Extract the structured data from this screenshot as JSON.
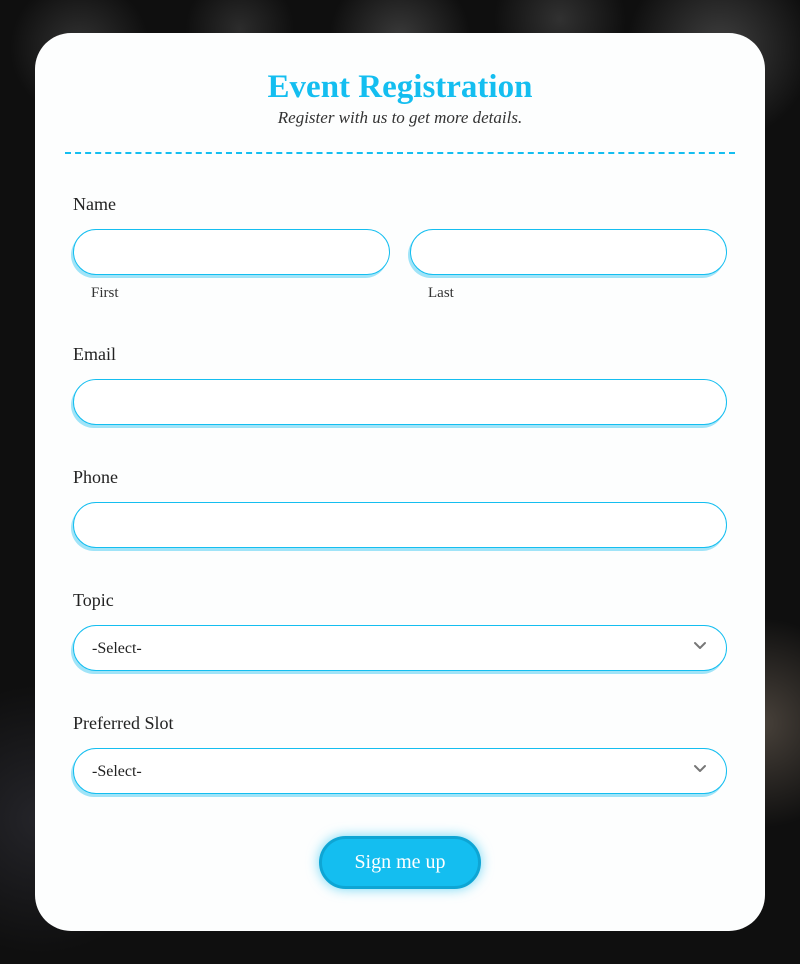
{
  "header": {
    "title": "Event Registration",
    "subtitle": "Register with us to get more details."
  },
  "fields": {
    "name": {
      "label": "Name",
      "first_sublabel": "First",
      "last_sublabel": "Last",
      "first_value": "",
      "last_value": ""
    },
    "email": {
      "label": "Email",
      "value": ""
    },
    "phone": {
      "label": "Phone",
      "value": ""
    },
    "topic": {
      "label": "Topic",
      "selected": "-Select-"
    },
    "slot": {
      "label": "Preferred Slot",
      "selected": "-Select-"
    }
  },
  "submit": {
    "label": "Sign me up"
  },
  "colors": {
    "accent": "#14bef0"
  }
}
